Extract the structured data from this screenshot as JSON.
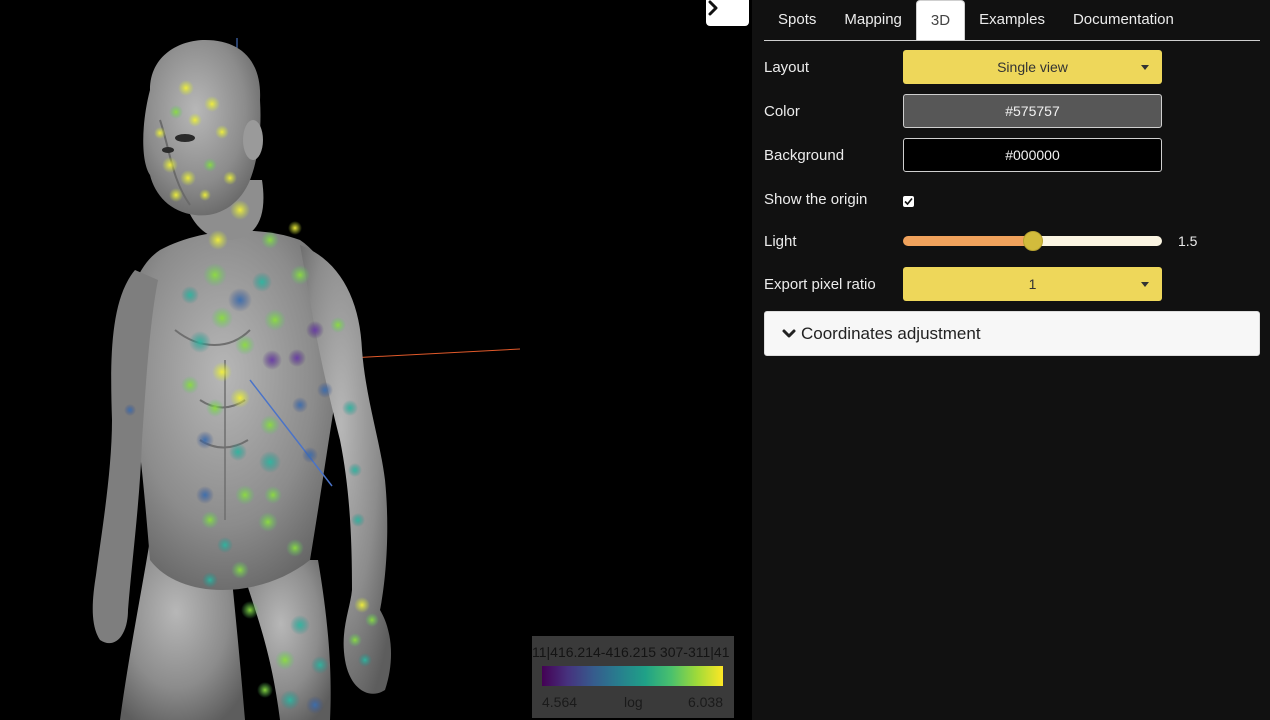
{
  "panel": {
    "tabs": [
      {
        "label": "Spots",
        "active": false
      },
      {
        "label": "Mapping",
        "active": false
      },
      {
        "label": "3D",
        "active": true
      },
      {
        "label": "Examples",
        "active": false
      },
      {
        "label": "Documentation",
        "active": false
      }
    ],
    "layout": {
      "label": "Layout",
      "value": "Single view"
    },
    "color": {
      "label": "Color",
      "value": "#575757"
    },
    "background": {
      "label": "Background",
      "value": "#000000"
    },
    "show_origin": {
      "label": "Show the origin",
      "checked": true
    },
    "light": {
      "label": "Light",
      "value": "1.5",
      "fraction": 0.5
    },
    "export_ratio": {
      "label": "Export pixel ratio",
      "value": "1"
    },
    "coordinates": {
      "label": "Coordinates adjustment"
    }
  },
  "legend": {
    "title": "11|416.214-416.215 307-311|41",
    "min": "4.564",
    "scale": "log",
    "max": "6.038"
  },
  "colors": {
    "accent": "#eed75a",
    "panel_bg": "#111111",
    "model": "#575757",
    "viewport_bg": "#000000"
  },
  "icons": {
    "toggle": "chevron-right-icon",
    "accordion": "chevron-down-icon",
    "checkbox": "check-icon"
  }
}
